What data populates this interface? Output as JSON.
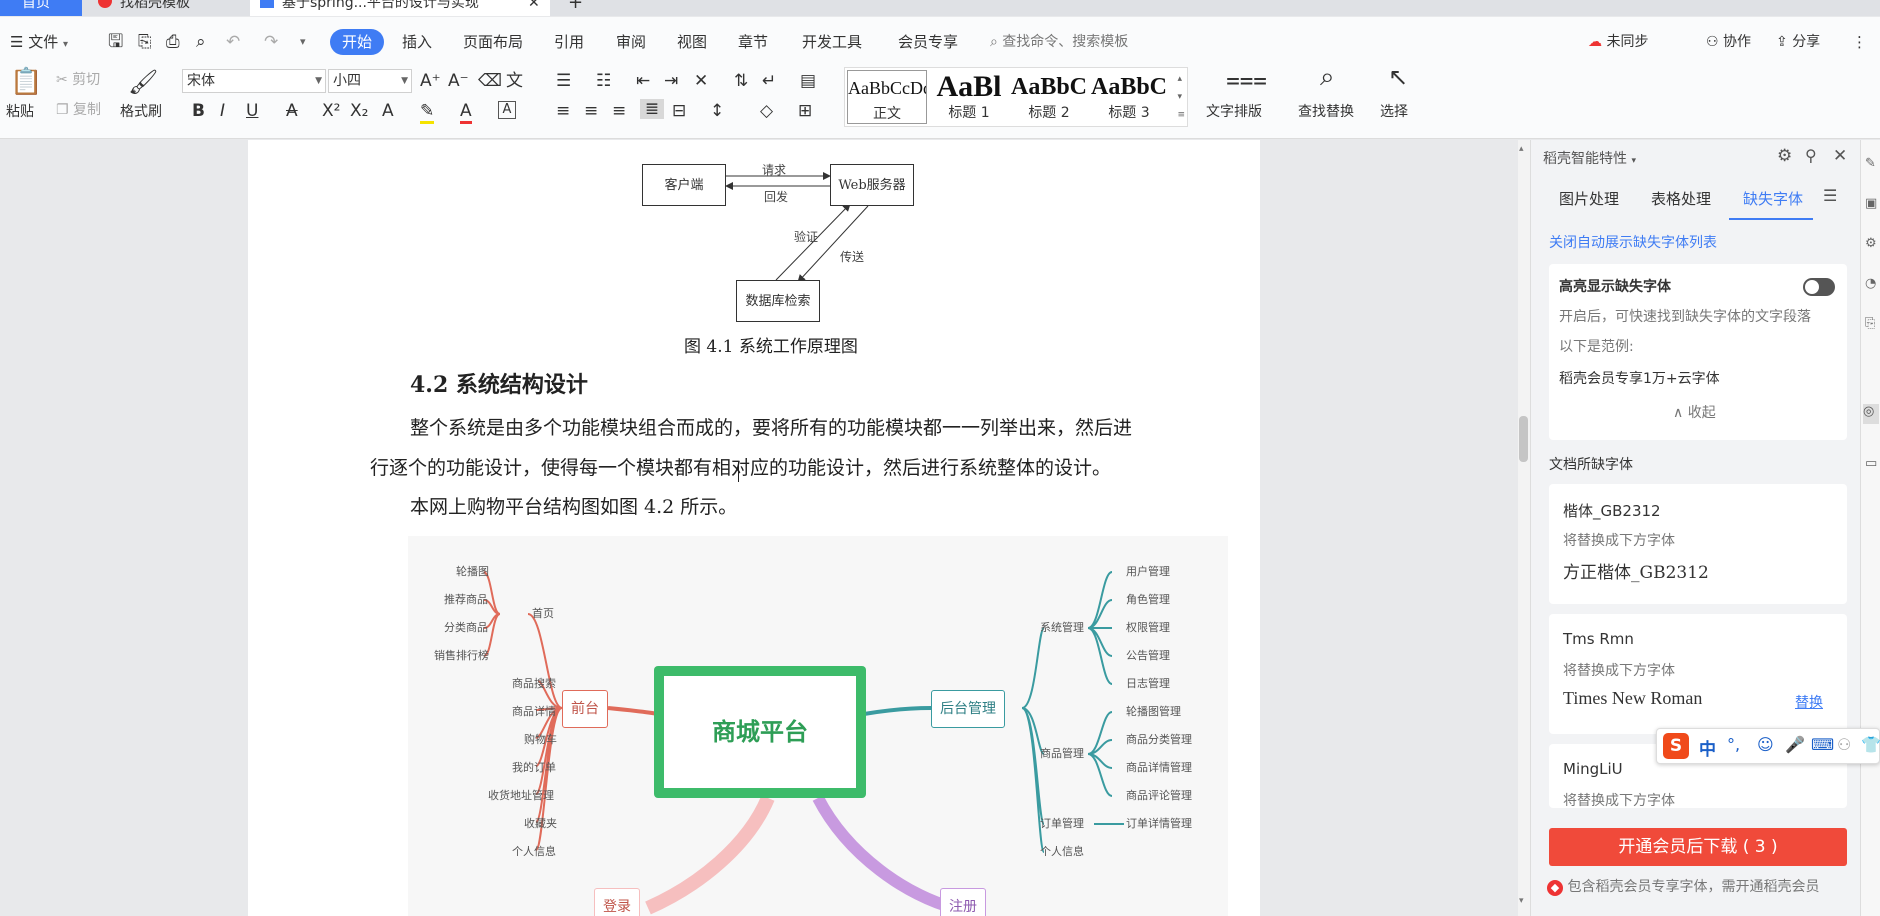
{
  "tabs": [
    {
      "label": "首页"
    },
    {
      "label": "找稻壳模板"
    },
    {
      "label": "基于spring...平台的设计与实现"
    }
  ],
  "menu": {
    "file": "文件",
    "items": [
      "开始",
      "插入",
      "页面布局",
      "引用",
      "审阅",
      "视图",
      "章节",
      "开发工具",
      "会员专享"
    ],
    "search_placeholder": "查找命令、搜索模板",
    "sync": "未同步",
    "collab": "协作",
    "share": "分享"
  },
  "ribbon": {
    "paste": "粘贴",
    "cut": "剪切",
    "copy": "复制",
    "format_painter": "格式刷",
    "font_name": "宋体",
    "font_size": "小四",
    "styles": [
      {
        "sample": "AaBbCcDd",
        "label": "正文"
      },
      {
        "sample": "AaBl",
        "label": "标题 1"
      },
      {
        "sample": "AaBbC",
        "label": "标题 2"
      },
      {
        "sample": "AaBbC",
        "label": "标题 3"
      }
    ],
    "text_layout": "文字排版",
    "find_replace": "查找替换",
    "select": "选择"
  },
  "document": {
    "fig1": {
      "client": "客户端",
      "server": "Web服务器",
      "db": "数据库检索",
      "request": "请求",
      "reply": "回发",
      "verify": "验证",
      "transfer": "传送",
      "caption": "图 4.1    系统工作原理图"
    },
    "heading": "4.2  系统结构设计",
    "para1_line1": "整个系统是由多个功能模块组合而成的，要将所有的功能模块都一一列举出来，然后进",
    "para1_line2": "行逐个的功能设计，使得每一个模块都有相对应的功能设计，然后进行系统整体的设计。",
    "para2": "本网上购物平台结构图如图 4.2 所示。",
    "mindmap": {
      "center": "商城平台",
      "front": "前台",
      "back": "后台管理",
      "login": "登录",
      "register": "注册",
      "home": "首页",
      "home_items": [
        "轮播图",
        "推荐商品",
        "分类商品",
        "销售排行榜"
      ],
      "front_items": [
        "商品搜索",
        "商品详情",
        "购物车",
        "我的订单",
        "收货地址管理",
        "收藏夹",
        "个人信息"
      ],
      "sys_mgmt": "系统管理",
      "sys_items": [
        "用户管理",
        "角色管理",
        "权限管理",
        "公告管理",
        "日志管理"
      ],
      "goods_mgmt": "商品管理",
      "goods_items": [
        "轮播图管理",
        "商品分类管理",
        "商品详情管理",
        "商品评论管理"
      ],
      "order_mgmt": "订单管理",
      "order_item": "订单详情管理",
      "personal": "个人信息"
    }
  },
  "panel": {
    "title": "稻壳智能特性",
    "tabs": [
      "图片处理",
      "表格处理",
      "缺失字体"
    ],
    "close_auto": "关闭自动展示缺失字体列表",
    "highlight_title": "高亮显示缺失字体",
    "highlight_desc": "开启后，可快速找到缺失字体的文字段落",
    "example_label": "以下是范例:",
    "example_value": "稻壳会员专享1万+云字体",
    "collapse": "收起",
    "missing_header": "文档所缺字体",
    "fonts": [
      {
        "name": "楷体_GB2312",
        "hint": "将替换成下方字体",
        "replacement": "方正楷体_GB2312",
        "action": ""
      },
      {
        "name": "Tms Rmn",
        "hint": "将替换成下方字体",
        "replacement": "Times New Roman",
        "action": "替换"
      },
      {
        "name": "MingLiU",
        "hint": "将替换成下方字体",
        "replacement": "",
        "action": ""
      }
    ],
    "download_btn": "开通会员后下载 ( 3 )",
    "footer_note": "包含稻壳会员专享字体，需开通稻壳会员"
  },
  "ime": {
    "lang": "中"
  },
  "colors": {
    "accent": "#3f7cf4",
    "download": "#f04a3a",
    "mindmap_red": "#e06b5a",
    "mindmap_teal": "#3a9ba0",
    "mindmap_green": "#3dbb6a"
  }
}
